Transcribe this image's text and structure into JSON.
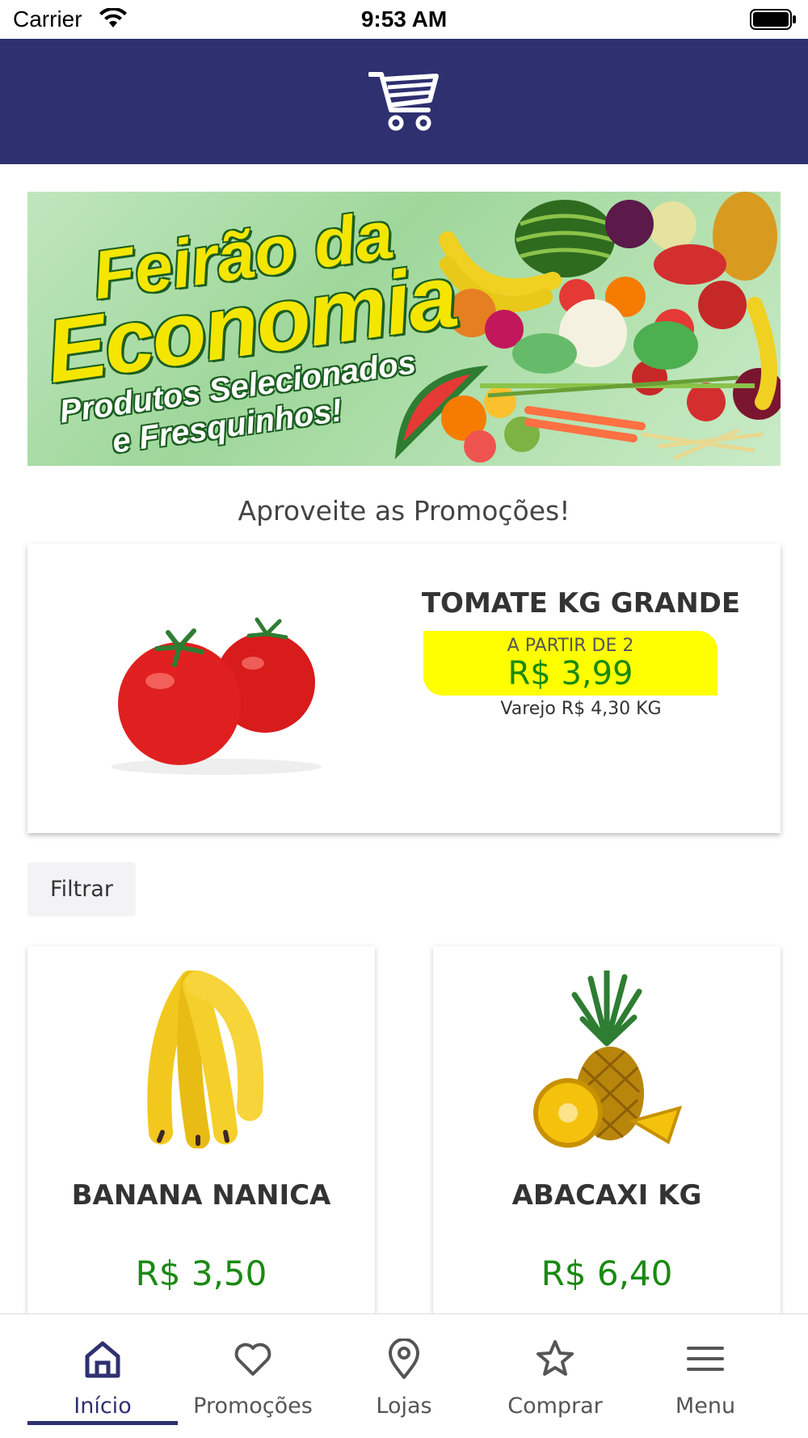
{
  "status_bar": {
    "carrier": "Carrier",
    "time": "9:53 AM"
  },
  "header": {
    "logo_icon": "shopping-cart-icon",
    "brand_color": "#2e3070"
  },
  "banner": {
    "title_line1": "Feirão da",
    "title_line2": "Economia",
    "subtitle_line1": "Produtos Selecionados",
    "subtitle_line2": "e Fresquinhos!"
  },
  "promo_heading": "Aproveite as Promoções!",
  "featured": {
    "name": "TOMATE KG GRANDE",
    "price_prefix": "A PARTIR DE 2",
    "price": "R$ 3,99",
    "retail": "Varejo R$ 4,30 KG",
    "price_color": "#1a8a12",
    "highlight_color": "#ffff00"
  },
  "filter": {
    "label": "Filtrar"
  },
  "products": [
    {
      "name": "BANANA NANICA",
      "price": "R$ 3,50",
      "image": "banana"
    },
    {
      "name": "ABACAXI KG",
      "price": "R$ 6,40",
      "image": "pineapple"
    }
  ],
  "nav": {
    "items": [
      {
        "label": "Início",
        "icon": "home-icon",
        "active": true
      },
      {
        "label": "Promoções",
        "icon": "heart-icon",
        "active": false
      },
      {
        "label": "Lojas",
        "icon": "location-pin-icon",
        "active": false
      },
      {
        "label": "Comprar",
        "icon": "star-icon",
        "active": false
      },
      {
        "label": "Menu",
        "icon": "hamburger-menu-icon",
        "active": false
      }
    ]
  }
}
